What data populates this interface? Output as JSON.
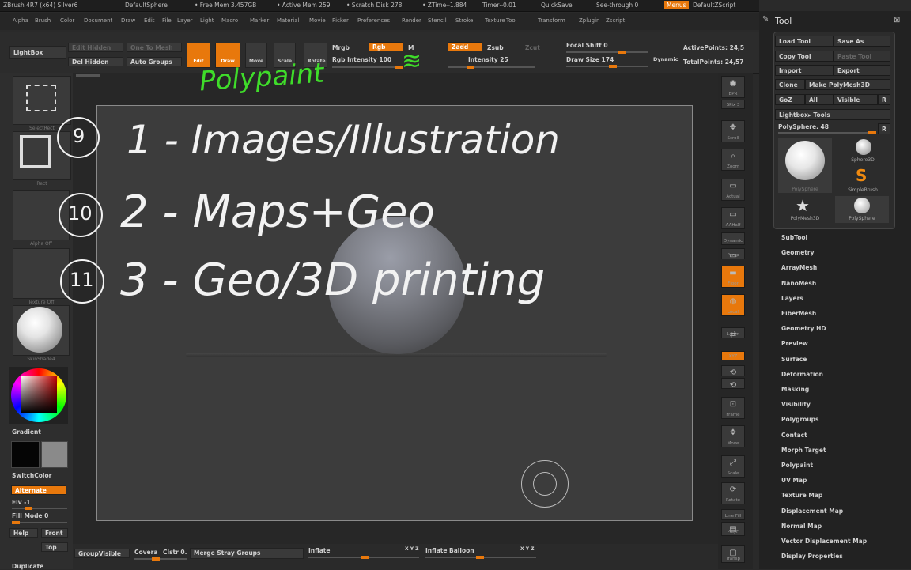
{
  "titlebar": {
    "app": "ZBrush 4R7 (x64) Silver6",
    "doc": "DefaultSphere",
    "free_mem": "• Free Mem 3.457GB",
    "active_mem": "• Active Mem 259",
    "scratch": "• Scratch Disk 278",
    "ztime": "• ZTime┄1.884",
    "timer": "Timer┄0.01",
    "quicksave": "QuickSave",
    "see_through": "See-through  0",
    "menus": "Menus",
    "script": "DefaultZScript"
  },
  "menubar": [
    "Alpha",
    "Brush",
    "Color",
    "Document",
    "Draw",
    "Edit",
    "File",
    "Layer",
    "Light",
    "Macro",
    "Marker",
    "Material",
    "Movie",
    "Picker",
    "Preferences",
    "Render",
    "Stencil",
    "Stroke",
    "Texture",
    "Tool",
    "Transform",
    "Zplugin",
    "Zscript"
  ],
  "topbar": {
    "lightbox": "LightBox",
    "edit_hidden": "Edit Hidden",
    "one_to_mesh": "One To Mesh",
    "del_hidden": "Del Hidden",
    "auto_groups": "Auto Groups",
    "edit": "Edit",
    "draw": "Draw",
    "move": "Move",
    "scale": "Scale",
    "rotate": "Rotate",
    "mrgb": "Mrgb",
    "rgb": "Rgb",
    "m": "M",
    "zadd": "Zadd",
    "zsub": "Zsub",
    "zcut": "Zcut",
    "rgb_intensity": "Rgb Intensity 100",
    "z_intensity": "Intensity 25",
    "focal_shift": "Focal Shift 0",
    "draw_size": "Draw Size 174",
    "dynamic": "Dynamic",
    "active_points": "ActivePoints: 24,5",
    "total_points": "TotalPoints: 24,57"
  },
  "leftpanel": {
    "thumbs": [
      "SelectRect",
      "Rect",
      "Alpha Off",
      "Texture Off",
      "SkinShade4"
    ],
    "gradient": "Gradient",
    "switchcolor": "SwitchColor",
    "alternate": "Alternate",
    "elv": "Elv -1",
    "fill_mode": "Fill Mode 0",
    "help": "Help",
    "front": "Front",
    "top": "Top",
    "duplicate": "Duplicate"
  },
  "rightdock": [
    "BPR",
    "SPix 3",
    "Scroll",
    "Zoom",
    "Actual",
    "AAHalf",
    "Dynamic",
    "Persp",
    "Floor",
    "Local",
    "L.Sym",
    "XYZ",
    "",
    "",
    "Frame",
    "Move",
    "Scale",
    "Rotate",
    "Line Fill",
    "PolyF",
    "Transp"
  ],
  "toolpanel": {
    "title": "Tool",
    "load_tool": "Load Tool",
    "save_as": "Save As",
    "copy_tool": "Copy Tool",
    "paste_tool": "Paste Tool",
    "import": "Import",
    "export": "Export",
    "clone": "Clone",
    "make_polymesh": "Make PolyMesh3D",
    "goz": "GoZ",
    "all": "All",
    "visible": "Visible",
    "r": "R",
    "lightbox_tools": "Lightbox▸ Tools",
    "current_tool": "PolySphere. 48",
    "tool_thumbs": [
      "PolySphere",
      "Sphere3D",
      "SimpleBrush",
      "PolyMesh3D",
      "PolySphere"
    ],
    "sections": [
      "SubTool",
      "Geometry",
      "ArrayMesh",
      "NanoMesh",
      "Layers",
      "FiberMesh",
      "Geometry HD",
      "Preview",
      "Surface",
      "Deformation",
      "Masking",
      "Visibility",
      "Polygroups",
      "Contact",
      "Morph Target",
      "Polypaint",
      "UV Map",
      "Texture Map",
      "Displacement Map",
      "Normal Map",
      "Vector Displacement Map",
      "Display Properties"
    ]
  },
  "bottombar": {
    "group_visible": "GroupVisible",
    "coverage": "Covera",
    "clstr": "Clstr 0.",
    "merge_stray": "Merge Stray Groups",
    "inflate": "Inflate",
    "xyz1": "X Y Z",
    "inflate_balloon": "Inflate Balloon",
    "xyz2": "X Y Z"
  },
  "annotations": {
    "polypaint": "Polypaint",
    "n9": "9",
    "n10": "10",
    "n11": "11",
    "line1": "1 - Images/Illustration",
    "line2": "2 - Maps+Geo",
    "line3": "3 - Geo/3D printing"
  }
}
